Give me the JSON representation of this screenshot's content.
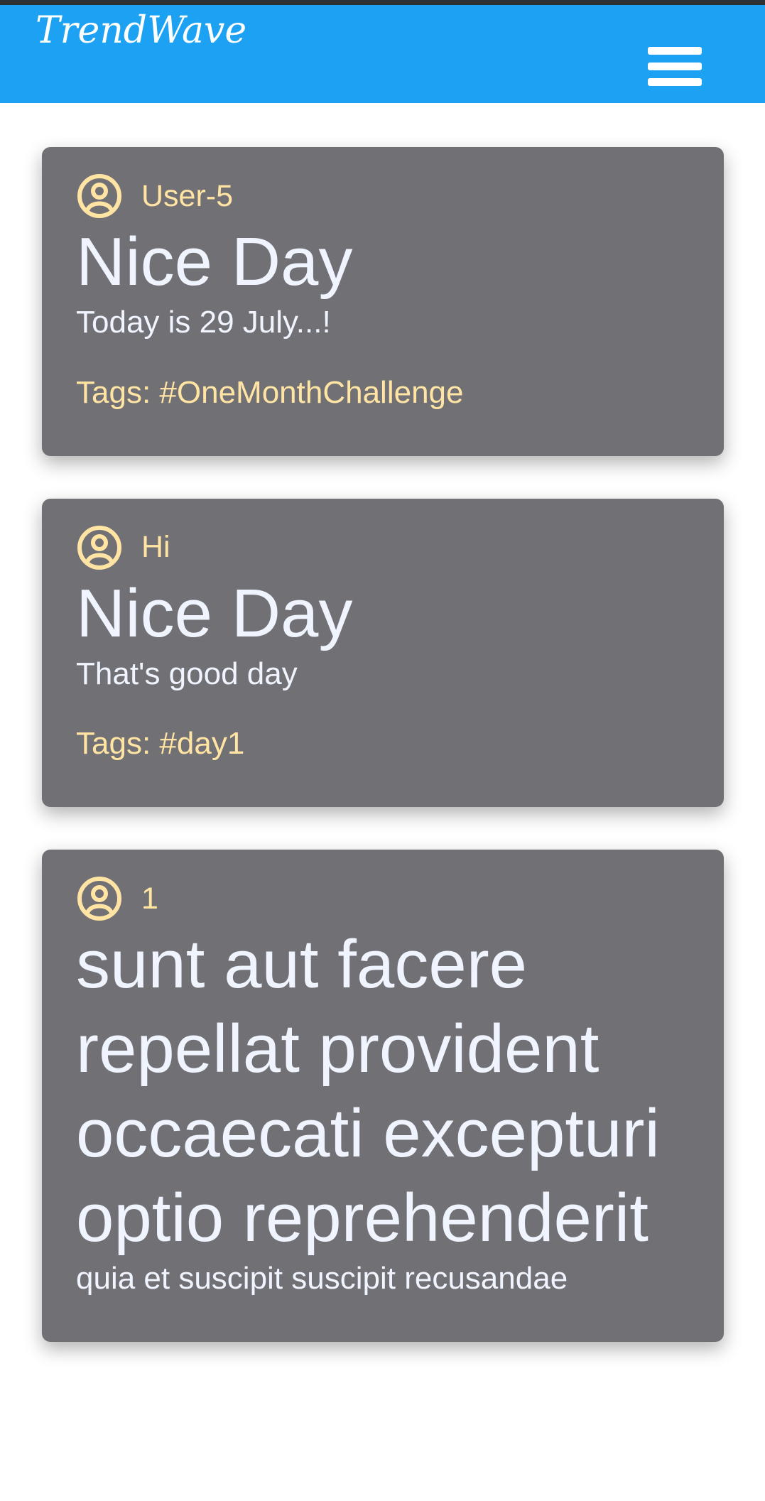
{
  "app": {
    "brand": "TrendWave"
  },
  "header": {
    "menu_icon": "hamburger-menu-icon"
  },
  "posts": [
    {
      "user_icon": "user-circle-icon",
      "username": "User-5",
      "title": "Nice Day",
      "body": "Today is 29 July...!",
      "tags_label": "Tags:",
      "tags": "#OneMonthChallenge"
    },
    {
      "user_icon": "user-circle-icon",
      "username": "Hi",
      "title": "Nice Day",
      "body": "That's good day",
      "tags_label": "Tags:",
      "tags": "#day1"
    },
    {
      "user_icon": "user-circle-icon",
      "username": "1",
      "title": "sunt aut facere repellat provident occaecati excepturi optio reprehenderit",
      "body": "quia et suscipit suscipit recusandae",
      "tags_label": "",
      "tags": ""
    }
  ],
  "colors": {
    "header": "#1da1f2",
    "card": "#717075",
    "accent_text": "#ffe4a3",
    "primary_text": "#f0f4ff"
  }
}
